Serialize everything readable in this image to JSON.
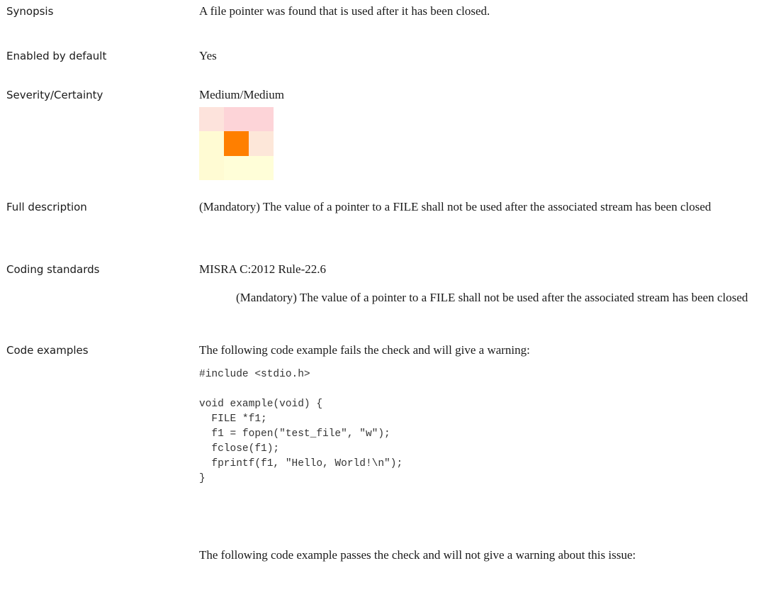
{
  "rows": [
    {
      "label": "Synopsis",
      "value": "A file pointer was found that is used after it has been closed."
    },
    {
      "label": "Enabled by default",
      "value": "Yes"
    },
    {
      "label": "Severity/Certainty",
      "value": "Medium/Medium"
    },
    {
      "label": "Full description",
      "value": " (Mandatory) The value of a pointer to a FILE shall not be used after the associated stream has been closed"
    },
    {
      "label": "Coding standards",
      "value": "MISRA C:2012 Rule-22.6",
      "note": "(Mandatory) The value of a pointer to a FILE shall not be used after the associated stream has been closed"
    },
    {
      "label": "Code examples",
      "value": "The following code example fails the check and will give a warning:"
    }
  ],
  "severity_matrix": {
    "colors": [
      [
        "#fde3dc",
        "#fdd4d8",
        "#fdd4d8"
      ],
      [
        "#fffbd3",
        "#ff7f00",
        "#fde7d9"
      ],
      [
        "#fffbd3",
        "#fffed8",
        "#fffed8"
      ]
    ]
  },
  "code_fail": [
    "#include <stdio.h>",
    "",
    "void example(void) {",
    "  FILE *f1;",
    "  f1 = fopen(\"test_file\", \"w\");",
    "  fclose(f1);",
    "  fprintf(f1, \"Hello, World!\\n\");",
    "}"
  ],
  "pass_intro": "The following code example passes the check and will not give a warning about this issue:"
}
